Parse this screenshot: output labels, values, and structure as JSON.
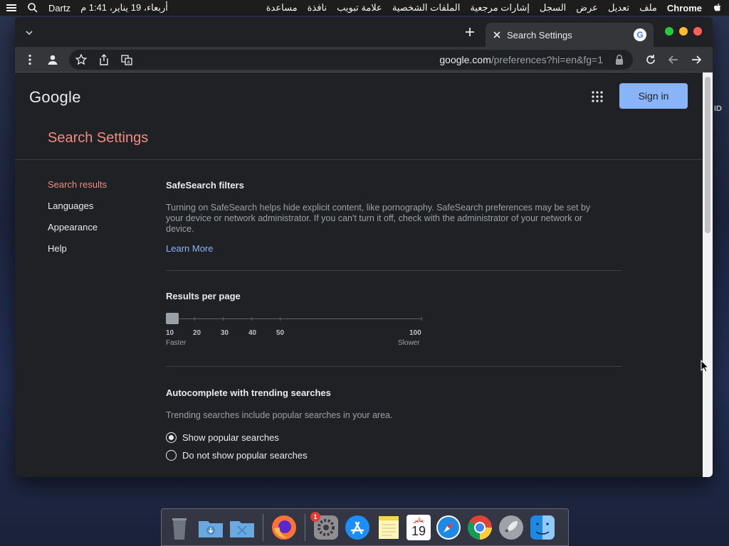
{
  "menubar": {
    "apple_icon": "apple-icon",
    "app": "Chrome",
    "menus": [
      "ملف",
      "تعديل",
      "عرض",
      "السجل",
      "إشارات مرجعية",
      "الملفات الشخصية",
      "علامة تبويب",
      "نافذة",
      "مساعدة"
    ],
    "clock": "أربعاء، 19 يناير، 1:41 م",
    "user": "Dartz",
    "search_icon": "search-icon",
    "control_icon": "control-center-icon"
  },
  "desktop": {
    "side_label": "ID"
  },
  "tab": {
    "title": "Search Settings",
    "favicon": "G"
  },
  "toolbar": {
    "url_host": "google.com",
    "url_path": "/preferences?hl=en&fg=1"
  },
  "page": {
    "logo": "Google",
    "sign_in": "Sign in",
    "title": "Search Settings",
    "nav": [
      "Search results",
      "Languages",
      "Appearance",
      "Help"
    ],
    "safesearch": {
      "title": "SafeSearch filters",
      "description": "Turning on SafeSearch helps hide explicit content, like pornography. SafeSearch preferences may be set by your device or network administrator. If you can't turn it off, check with the administrator of your network or device.",
      "learn_more": "Learn More"
    },
    "results_per_page": {
      "title": "Results per page",
      "ticks": [
        "10",
        "20",
        "30",
        "40",
        "50",
        "100"
      ],
      "selected": "10",
      "faster": "Faster",
      "slower": "Slower"
    },
    "autocomplete": {
      "title": "Autocomplete with trending searches",
      "description": "Trending searches include popular searches in your area.",
      "options": [
        "Show popular searches",
        "Do not show popular searches"
      ],
      "selected_index": 0
    }
  },
  "dock": {
    "items": [
      "Trash",
      "Downloads",
      "Utilities",
      "Firefox",
      "System Preferences",
      "App Store",
      "Notes",
      "Calendar",
      "Safari",
      "Chrome",
      "Launchpad",
      "Finder"
    ],
    "calendar_day": "19",
    "calendar_month": "يناير",
    "badge": "1"
  }
}
